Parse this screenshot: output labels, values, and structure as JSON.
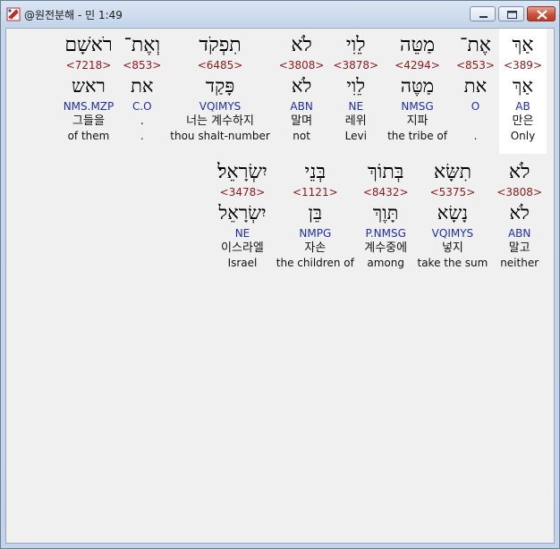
{
  "window": {
    "title": "@원전분해 - 민 1:49",
    "controls": {
      "minimize_icon": "minimize-icon",
      "maximize_icon": "maximize-icon",
      "close_icon": "close-icon"
    }
  },
  "rows": [
    [
      {
        "hebrew": "אַךְ",
        "strong": "<389>",
        "lemma": "אַךְ",
        "parse": "AB",
        "korean": "만은",
        "english": "Only",
        "selected": true
      },
      {
        "hebrew": "אֶת־",
        "strong": "<853>",
        "lemma": "את",
        "parse": "O",
        "korean": "",
        "english": "."
      },
      {
        "hebrew": "מַטֵּה",
        "strong": "<4294>",
        "lemma": "מַטֶּה",
        "parse": "NMSG",
        "korean": "지파",
        "english": "the tribe of"
      },
      {
        "hebrew": "לֵוִי",
        "strong": "<3878>",
        "lemma": "לֵוִי",
        "parse": "NE",
        "korean": "레위",
        "english": "Levi"
      },
      {
        "hebrew": "לֹא",
        "strong": "<3808>",
        "lemma": "לֹא",
        "parse": "ABN",
        "korean": "말며",
        "english": "not"
      },
      {
        "hebrew": "תִפְקֹד",
        "strong": "<6485>",
        "lemma": "פָּקַד",
        "parse": "VQIMYS",
        "korean": "너는 계수하지",
        "english": "thou shalt-number"
      },
      {
        "hebrew": "וְאֶת־",
        "strong": "<853>",
        "lemma": "את",
        "parse": "C.O",
        "korean": ".",
        "english": "."
      },
      {
        "hebrew": "רֹאשָׁם",
        "strong": "<7218>",
        "lemma": "ראש",
        "parse": "NMS.MZP",
        "korean": "그들을",
        "english": "of them"
      }
    ],
    [
      {
        "hebrew": "לֹא",
        "strong": "<3808>",
        "lemma": "לֹא",
        "parse": "ABN",
        "korean": "말고",
        "english": "neither"
      },
      {
        "hebrew": "תִשָּׂא",
        "strong": "<5375>",
        "lemma": "נָשָׂא",
        "parse": "VQIMYS",
        "korean": "넣지",
        "english": "take the sum"
      },
      {
        "hebrew": "בְּתוֹךְ",
        "strong": "<8432>",
        "lemma": "תָּוֶךְ",
        "parse": "P.NMSG",
        "korean": "계수중에",
        "english": "among"
      },
      {
        "hebrew": "בְּנֵי",
        "strong": "<1121>",
        "lemma": "בֵּן",
        "parse": "NMPG",
        "korean": "자손",
        "english": "the children of"
      },
      {
        "hebrew": "יִשְׂרָאֵל׃",
        "strong": "<3478>",
        "lemma": "יִשְׂרָאֵל",
        "parse": "NE",
        "korean": "이스라엘",
        "english": "Israel"
      }
    ]
  ]
}
